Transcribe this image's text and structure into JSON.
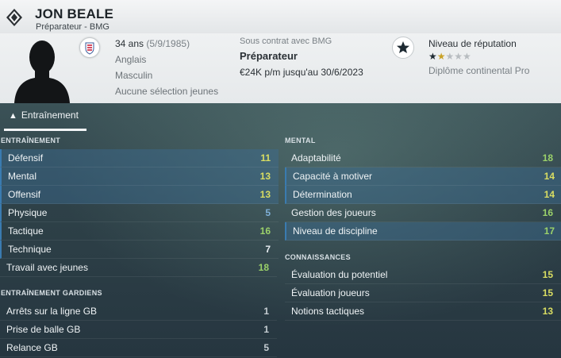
{
  "header": {
    "name": "JON BEALE",
    "subtitle": "Préparateur - BMG"
  },
  "info": {
    "age": "34 ans",
    "dob": "(5/9/1985)",
    "nationality": "Anglais",
    "gender": "Masculin",
    "youth": "Aucune sélection jeunes",
    "contract_label": "Sous contrat avec BMG",
    "role": "Préparateur",
    "salary": "€24K p/m jusqu'au 30/6/2023",
    "reputation_label": "Niveau de réputation",
    "reputation_stars": 1.5,
    "reputation_max": 5,
    "diploma": "Diplôme continental Pro"
  },
  "tabs": [
    {
      "label": "Entraînement"
    }
  ],
  "sections": {
    "training": {
      "title": "ENTRAÎNEMENT",
      "rows": [
        {
          "label": "Défensif",
          "value": "11"
        },
        {
          "label": "Mental",
          "value": "13"
        },
        {
          "label": "Offensif",
          "value": "13"
        },
        {
          "label": "Physique",
          "value": "5"
        },
        {
          "label": "Tactique",
          "value": "16"
        },
        {
          "label": "Technique",
          "value": "7"
        },
        {
          "label": "Travail avec jeunes",
          "value": "18"
        }
      ]
    },
    "gk": {
      "title": "ENTRAÎNEMENT GARDIENS",
      "rows": [
        {
          "label": "Arrêts sur la ligne GB",
          "value": "1"
        },
        {
          "label": "Prise de balle GB",
          "value": "1"
        },
        {
          "label": "Relance GB",
          "value": "5"
        }
      ]
    },
    "mental": {
      "title": "MENTAL",
      "rows": [
        {
          "label": "Adaptabilité",
          "value": "18"
        },
        {
          "label": "Capacité à motiver",
          "value": "14"
        },
        {
          "label": "Détermination",
          "value": "14"
        },
        {
          "label": "Gestion des joueurs",
          "value": "16"
        },
        {
          "label": "Niveau de discipline",
          "value": "17"
        }
      ]
    },
    "knowledge": {
      "title": "CONNAISSANCES",
      "rows": [
        {
          "label": "Évaluation du potentiel",
          "value": "15"
        },
        {
          "label": "Évaluation joueurs",
          "value": "15"
        },
        {
          "label": "Notions tactiques",
          "value": "13"
        }
      ]
    }
  },
  "icons": {
    "club_badge": "club-badge-icon",
    "flag": "england-flag-icon",
    "reputation": "star-icon",
    "tab": "training-cone-icon"
  }
}
